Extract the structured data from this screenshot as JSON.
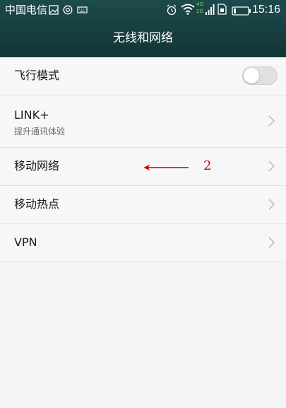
{
  "status_bar": {
    "carrier": "中国电信",
    "network_4g": "4G",
    "network_2g": "2G",
    "time": "15:16"
  },
  "header": {
    "title": "无线和网络"
  },
  "settings": {
    "airplane_mode": {
      "label": "飞行模式",
      "enabled": false
    },
    "link_plus": {
      "label": "LINK+",
      "subtitle": "提升通讯体验"
    },
    "mobile_network": {
      "label": "移动网络"
    },
    "hotspot": {
      "label": "移动热点"
    },
    "vpn": {
      "label": "VPN"
    }
  },
  "annotation": {
    "number": "2"
  },
  "colors": {
    "header_bg": "#1d4a4c",
    "annotation": "#cc0000"
  }
}
